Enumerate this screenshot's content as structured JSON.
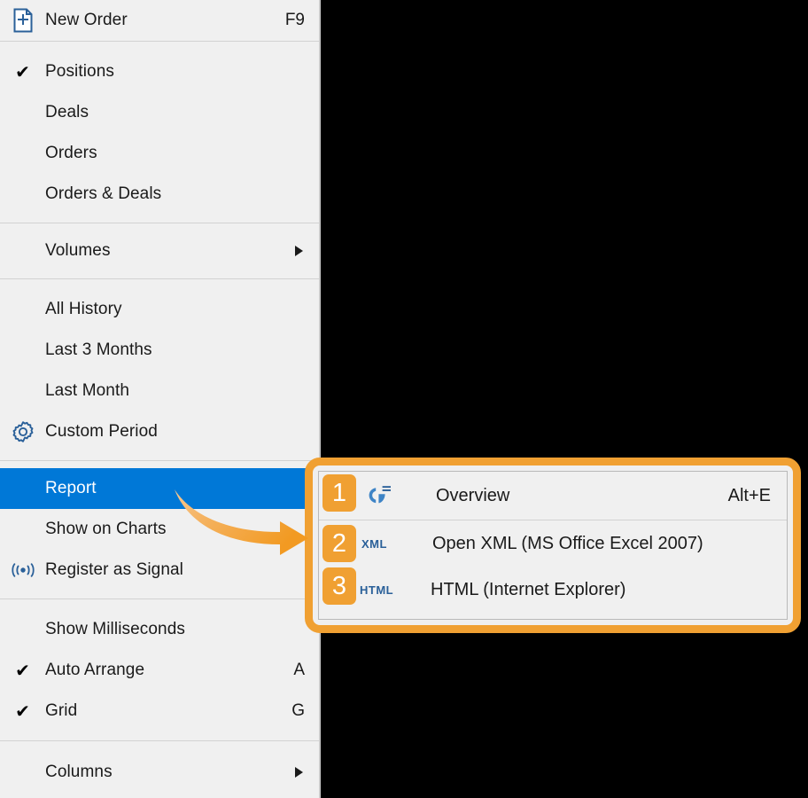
{
  "theme": {
    "menu_background": "#f0f0f0",
    "selected_background": "#0078d7",
    "selected_text": "#ffffff",
    "accent_orange": "#f0a032",
    "icon_blue": "#2a6099",
    "separator": "#d2d2d2",
    "text": "#1a1a1a"
  },
  "main_menu": {
    "groups": [
      {
        "items": [
          {
            "label": "New Order",
            "accel": "F9",
            "icon": "new-order-document-plus-icon",
            "checked": false,
            "submenu": false
          }
        ]
      },
      {
        "items": [
          {
            "label": "Positions",
            "accel": "",
            "icon": "",
            "checked": true,
            "submenu": false
          },
          {
            "label": "Deals",
            "accel": "",
            "icon": "",
            "checked": false,
            "submenu": false
          },
          {
            "label": "Orders",
            "accel": "",
            "icon": "",
            "checked": false,
            "submenu": false
          },
          {
            "label": "Orders & Deals",
            "accel": "",
            "icon": "",
            "checked": false,
            "submenu": false
          }
        ]
      },
      {
        "items": [
          {
            "label": "Volumes",
            "accel": "",
            "icon": "",
            "checked": false,
            "submenu": true
          }
        ]
      },
      {
        "items": [
          {
            "label": "All History",
            "accel": "",
            "icon": "",
            "checked": false,
            "submenu": false
          },
          {
            "label": "Last 3 Months",
            "accel": "",
            "icon": "",
            "checked": false,
            "submenu": false
          },
          {
            "label": "Last Month",
            "accel": "",
            "icon": "",
            "checked": false,
            "submenu": false
          },
          {
            "label": "Custom Period",
            "accel": "",
            "icon": "gear-icon",
            "checked": false,
            "submenu": false
          }
        ]
      },
      {
        "items": [
          {
            "label": "Report",
            "accel": "",
            "icon": "",
            "checked": false,
            "submenu": false,
            "selected": true
          },
          {
            "label": "Show on Charts",
            "accel": "",
            "icon": "",
            "checked": false,
            "submenu": false
          },
          {
            "label": "Register as Signal",
            "accel": "",
            "icon": "signal-broadcast-icon",
            "checked": false,
            "submenu": false
          }
        ]
      },
      {
        "items": [
          {
            "label": "Show Milliseconds",
            "accel": "",
            "icon": "",
            "checked": false,
            "submenu": false
          },
          {
            "label": "Auto Arrange",
            "accel": "A",
            "icon": "",
            "checked": true,
            "submenu": false
          },
          {
            "label": "Grid",
            "accel": "G",
            "icon": "",
            "checked": true,
            "submenu": false
          }
        ]
      },
      {
        "items": [
          {
            "label": "Columns",
            "accel": "",
            "icon": "",
            "checked": false,
            "submenu": true
          }
        ]
      }
    ]
  },
  "report_submenu": {
    "items": [
      {
        "badge": "1",
        "icon": "pie-chart-report-icon",
        "icon_text": "",
        "label": "Overview",
        "accel": "Alt+E"
      },
      {
        "badge": "2",
        "icon": "xml-file-icon",
        "icon_text": "XML",
        "label": "Open XML (MS Office Excel 2007)",
        "accel": ""
      },
      {
        "badge": "3",
        "icon": "html-file-icon",
        "icon_text": "HTML",
        "label": "HTML (Internet Explorer)",
        "accel": ""
      }
    ]
  }
}
